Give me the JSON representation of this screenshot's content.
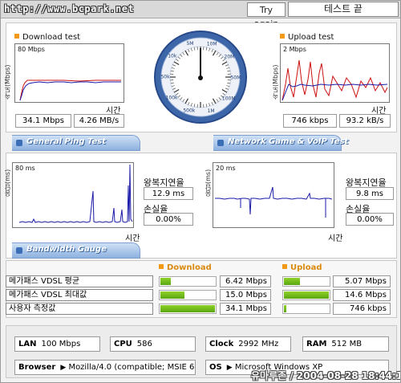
{
  "header": {
    "url": "http://www.bcpark.net",
    "try_again": "Try again",
    "test_end": "테스트 끝"
  },
  "download": {
    "title": "Download test",
    "axis_y": "속도(Mbps)",
    "scale": "80 Mbps",
    "axis_x": "시간",
    "mbps": "34.1 Mbps",
    "mbs": "4.26 MB/s"
  },
  "upload": {
    "title": "Upload test",
    "axis_y": "속도(Mbps)",
    "scale": "2 Mbps",
    "axis_x": "시간",
    "kbps": "746 kbps",
    "kbs": "93.2 kB/s"
  },
  "gauge": {
    "labels": [
      "5M",
      "10M",
      "20M",
      "50M",
      "100M",
      "1M",
      "500k",
      "100k",
      "50k",
      "10k"
    ]
  },
  "tabs": {
    "ping": "General Ping Test",
    "game": "Network Game & VoIP Test",
    "bandwidth": "Bandwidth Gauge"
  },
  "ping_general": {
    "axis_y": "응답(ms)",
    "scale": "80 ms",
    "axis_x": "시간",
    "rtt_label": "왕복지연율",
    "rtt": "12.9 ms",
    "loss_label": "손실율",
    "loss": "0.00%"
  },
  "ping_game": {
    "axis_y": "응답(ms)",
    "scale": "20 ms",
    "axis_x": "시간",
    "rtt_label": "왕복지연율",
    "rtt": "9.8 ms",
    "loss_label": "손실율",
    "loss": "0.00%"
  },
  "bandwidth": {
    "download_header": "Download",
    "upload_header": "Upload",
    "rows": [
      {
        "name": "메가패스 VDSL 평균",
        "down": "6.42 Mbps",
        "down_pct": 0.19,
        "up": "5.07 Mbps",
        "up_pct": 0.35
      },
      {
        "name": "메가패스 VDSL 최대값",
        "down": "15.0 Mbps",
        "down_pct": 0.44,
        "up": "14.6 Mbps",
        "up_pct": 1.0
      },
      {
        "name": "사용자 측정값",
        "down": "34.1 Mbps",
        "down_pct": 1.0,
        "up": "746 kbps",
        "up_pct": 0.05
      }
    ]
  },
  "specs": {
    "lan_label": "LAN",
    "lan": "100 Mbps",
    "cpu_label": "CPU",
    "cpu": "586",
    "clock_label": "Clock",
    "clock": "2992 MHz",
    "ram_label": "RAM",
    "ram": "512 MB",
    "browser_label": "Browser",
    "browser": "Mozilla/4.0 (compatible; MSIE 6.0",
    "os_label": "OS",
    "os": "Microsoft Windows XP"
  },
  "watermark": "유마루존 / 2004-08-28 18:44:12",
  "colors": {
    "tab_blue": "#8db1e0",
    "bar_green": "#5aa611",
    "series_blue": "#1a1aa8",
    "series_red": "#cc1010",
    "accent_orange": "#f29a16"
  }
}
